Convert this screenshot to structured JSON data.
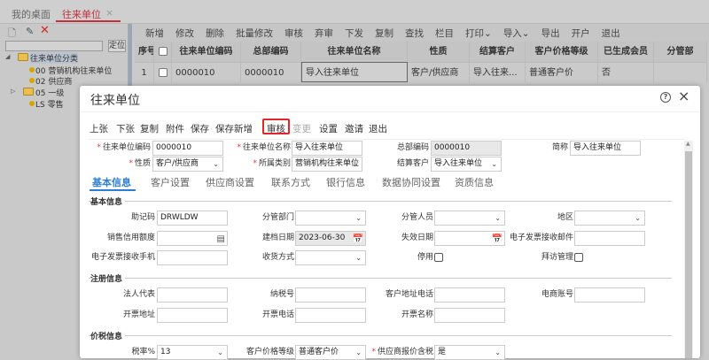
{
  "tabs": [
    {
      "label": "我的桌面"
    },
    {
      "label": "往来单位",
      "close": "×"
    }
  ],
  "left_panel": {
    "locate_button": "定位",
    "search_value": "",
    "tree": [
      {
        "label": "往来单位分类",
        "toggle": "◢"
      },
      {
        "label": "00 营销机构往来单位"
      },
      {
        "label": "02 供应商"
      },
      {
        "label": "05 一级",
        "toggle": "▷"
      },
      {
        "label": "LS 零售"
      }
    ]
  },
  "main_toolbar": [
    "新增",
    "修改",
    "删除",
    "批量修改",
    "审核",
    "弃审",
    "下发",
    "复制",
    "查找",
    "栏目",
    "打印⌄",
    "导入⌄",
    "导出",
    "开户",
    "退出"
  ],
  "grid": {
    "columns": [
      "序号",
      "",
      "往来单位编码",
      "总部编码",
      "往来单位名称",
      "性质",
      "结算客户",
      "客户价格等级",
      "已生成会员",
      "分管部"
    ],
    "rows": [
      [
        "1",
        "",
        "0000010",
        "0000010",
        "导入往来单位",
        "客户/供应商",
        "导入往来...",
        "普通客户价",
        "否",
        ""
      ]
    ]
  },
  "modal": {
    "title": "往来单位",
    "help": "?",
    "close": "×",
    "toolbar": [
      {
        "label": "上张"
      },
      {
        "label": "下张"
      },
      {
        "label": "复制"
      },
      {
        "label": "附件"
      },
      {
        "label": "保存"
      },
      {
        "label": "保存新增"
      },
      {
        "label": "审核",
        "highlighted": true
      },
      {
        "label": "变更",
        "disabled": true
      },
      {
        "label": "设置"
      },
      {
        "label": "邀请"
      },
      {
        "label": "退出"
      }
    ],
    "header_fields": [
      {
        "label": "往来单位编码",
        "value": "0000010",
        "required": true
      },
      {
        "label": "往来单位名称",
        "value": "导入往来单位",
        "required": true
      },
      {
        "label": "总部编码",
        "value": "0000010",
        "readonly": true
      },
      {
        "label": "简称",
        "value": "导入往来单位"
      },
      {
        "label": "性质",
        "value": "客户/供应商",
        "required": true,
        "select": true
      },
      {
        "label": "所属类别",
        "value": "营销机构往来单位",
        "required": true,
        "select": true
      },
      {
        "label": "结算客户",
        "value": "导入往来单位",
        "select": true
      }
    ],
    "form_tabs": [
      "基本信息",
      "客户设置",
      "供应商设置",
      "联系方式",
      "银行信息",
      "数据协同设置",
      "资质信息"
    ],
    "sections": [
      {
        "title": "基本信息",
        "fields": [
          {
            "label": "助记码",
            "value": "DRWLDW"
          },
          {
            "label": "分管部门",
            "value": "",
            "select": true
          },
          {
            "label": "分管人员",
            "value": "",
            "select": true
          },
          {
            "label": "地区",
            "value": "",
            "select": true
          },
          {
            "label": "销售信用额度",
            "value": "",
            "icon": "calculator"
          },
          {
            "label": "建档日期",
            "value": "2023-06-30",
            "icon": "calendar",
            "readonly": true
          },
          {
            "label": "失效日期",
            "value": "",
            "icon": "calendar"
          },
          {
            "label": "电子发票接收邮件",
            "value": ""
          },
          {
            "label": "电子发票接收手机",
            "value": ""
          },
          {
            "label": "收货方式",
            "value": "",
            "select": true
          },
          {
            "label": "停用",
            "checkbox": true,
            "checked": false
          },
          {
            "label": "拜访管理",
            "checkbox": true,
            "checked": false
          }
        ]
      },
      {
        "title": "注册信息",
        "fields": [
          {
            "label": "法人代表",
            "value": ""
          },
          {
            "label": "纳税号",
            "value": ""
          },
          {
            "label": "客户地址电话",
            "value": ""
          },
          {
            "label": "电商账号",
            "value": ""
          },
          {
            "label": "开票地址",
            "value": ""
          },
          {
            "label": "开票电话",
            "value": ""
          },
          {
            "label": "开票名称",
            "value": ""
          }
        ]
      },
      {
        "title": "价税信息",
        "fields": [
          {
            "label": "税率%",
            "value": "13",
            "select": true
          },
          {
            "label": "客户价格等级",
            "value": "普通客户价",
            "select": true
          },
          {
            "label": "供应商报价含税",
            "value": "是",
            "select": true,
            "required": true
          }
        ]
      }
    ]
  }
}
